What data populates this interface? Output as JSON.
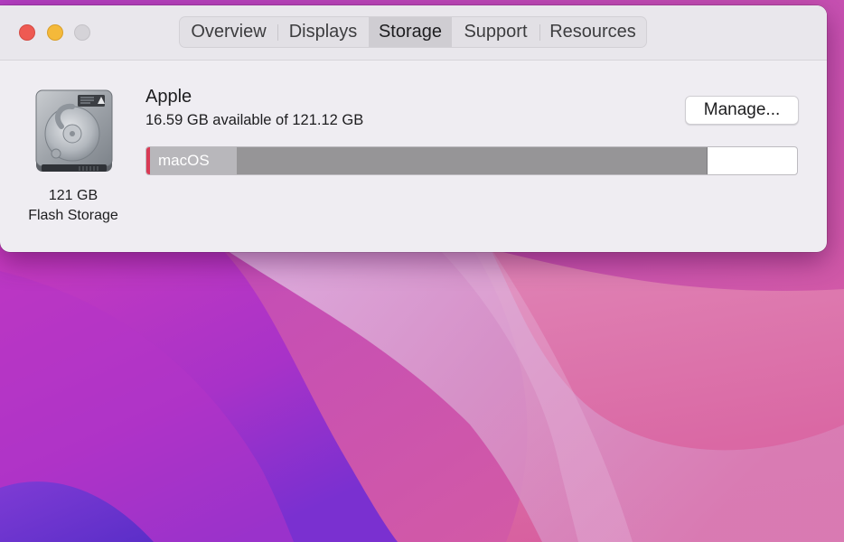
{
  "window": {
    "traffic_lights": {
      "close": "close-button",
      "minimize": "minimize-button",
      "zoom": "zoom-button"
    },
    "tabs": [
      {
        "label": "Overview",
        "active": false
      },
      {
        "label": "Displays",
        "active": false
      },
      {
        "label": "Storage",
        "active": true
      },
      {
        "label": "Support",
        "active": false
      },
      {
        "label": "Resources",
        "active": false
      }
    ]
  },
  "disk": {
    "icon": "hard-drive-icon",
    "size_label": "121 GB",
    "type_label": "Flash Storage"
  },
  "volume": {
    "name": "Apple",
    "available_text": "16.59 GB available of 121.12 GB",
    "manage_label": "Manage...",
    "capacity_gb": 121.12,
    "available_gb": 16.59,
    "segments": [
      {
        "name": "",
        "fraction": 0.005,
        "color": "#d93a55"
      },
      {
        "name": "macOS",
        "fraction": 0.134,
        "color": "#b8b7bb"
      },
      {
        "name": "",
        "fraction": 0.724,
        "color": "#969597"
      }
    ]
  },
  "colors": {
    "window_bg": "#efedf2",
    "titlebar_bg": "#e9e7ec",
    "close": "#ee5a52",
    "minimize": "#f4b93a",
    "zoom_inactive": "#d5d3d8"
  }
}
